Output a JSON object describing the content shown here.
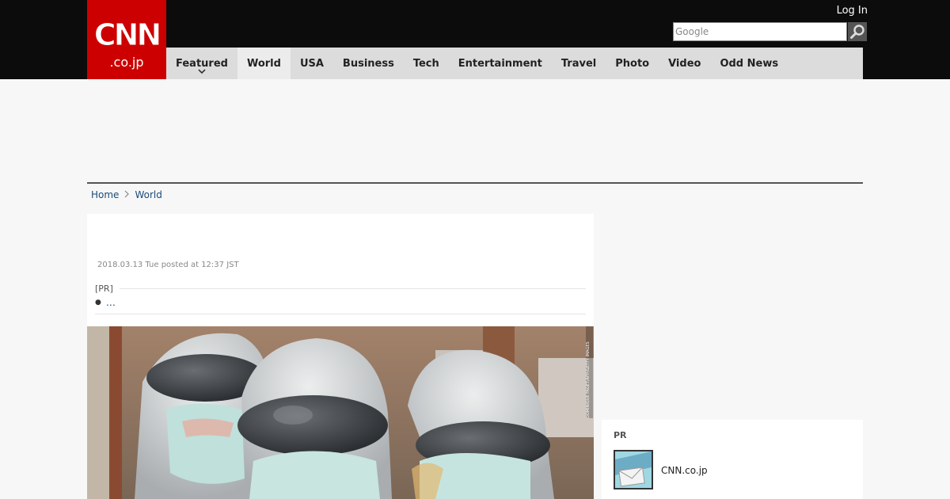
{
  "logo": {
    "top_text": "CNN",
    "bottom_text": ".co.jp"
  },
  "header": {
    "login_label": "Log In",
    "search_placeholder": "Google",
    "search_icon": "magnifier-icon"
  },
  "nav": {
    "items": [
      {
        "label": "Featured",
        "has_dropdown": true
      },
      {
        "label": "World",
        "active": true
      },
      {
        "label": "USA"
      },
      {
        "label": "Business"
      },
      {
        "label": "Tech"
      },
      {
        "label": "Entertainment"
      },
      {
        "label": "Travel"
      },
      {
        "label": "Photo"
      },
      {
        "label": "Video"
      },
      {
        "label": "Odd News"
      }
    ]
  },
  "breadcrumb": {
    "home": "Home",
    "current": "World"
  },
  "article": {
    "timestamp": "2018.03.13 Tue posted at 12:37 JST",
    "pr_label": "[PR]",
    "pr_link_text": "…",
    "photo_credit": "DOMINIQUE FAGET/AFP/GETTY IMAGES"
  },
  "sidebar": {
    "pr_heading": "PR",
    "pr_site": "CNN.co.jp"
  },
  "colors": {
    "brand_red": "#cc0000",
    "topbar": "#0c0c0c",
    "nav_bg": "#dcdcdc",
    "link": "#1a4b78"
  }
}
